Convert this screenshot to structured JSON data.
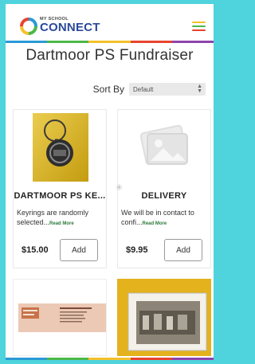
{
  "brand": {
    "small_text": "MY SCHOOL",
    "big_text": "CONNECT",
    "colors": [
      "#2a9ad6",
      "#4cb848",
      "#f5c02a",
      "#e8432e",
      "#8e44ad"
    ]
  },
  "menu": {
    "icon": "hamburger-menu-icon"
  },
  "page": {
    "title": "Dartmoor PS Fundraiser"
  },
  "sort": {
    "label": "Sort By",
    "selected": "Default",
    "icon": "up-down-chevron-icon"
  },
  "products": [
    {
      "name": "DARTMOOR PS KE...",
      "description": "Keyrings are randomly selected...",
      "read_more": "Read More",
      "price": "$15.00",
      "add_label": "Add",
      "image": "keyring-photo"
    },
    {
      "name": "DELIVERY",
      "description": "We will be in contact to confi...",
      "read_more": "Read More",
      "price": "$9.95",
      "add_label": "Add",
      "image": "placeholder-image-icon"
    }
  ],
  "products_row2": [
    {
      "image": "flyer-image"
    },
    {
      "image": "framed-photo-image"
    }
  ]
}
